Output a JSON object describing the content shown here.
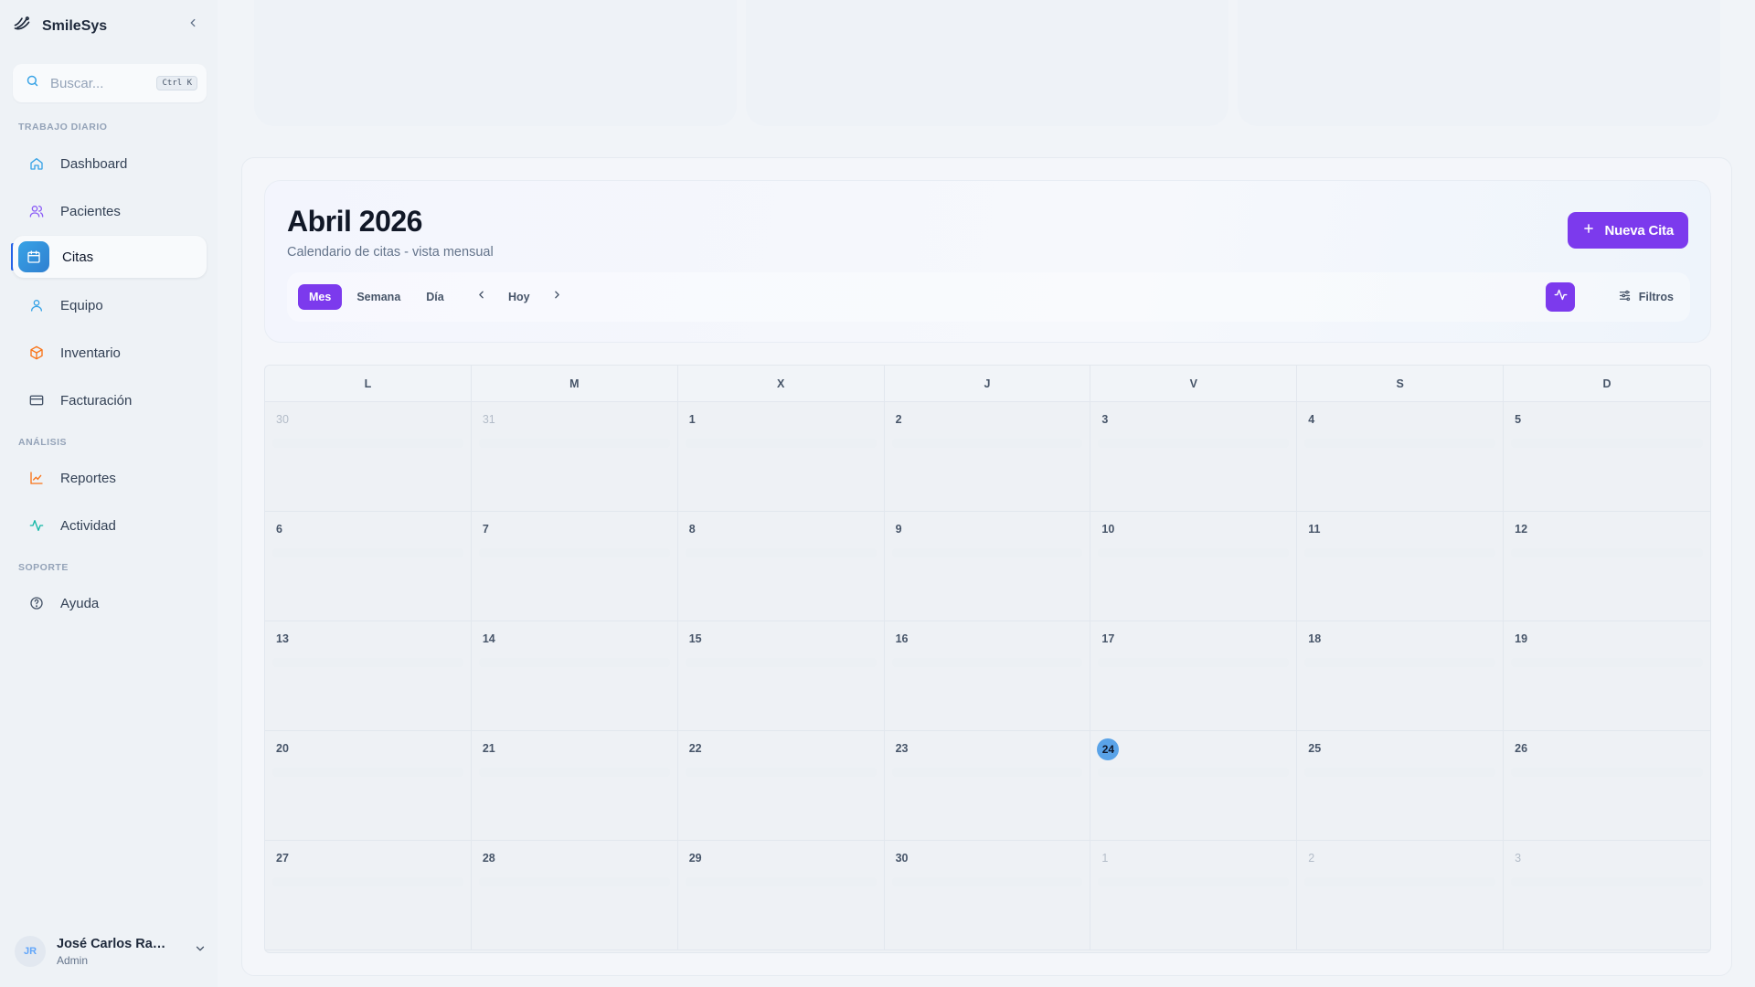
{
  "app": {
    "name": "SmileSys"
  },
  "search": {
    "placeholder": "Buscar...",
    "shortcut": "Ctrl K"
  },
  "sidebar": {
    "sections": [
      {
        "label": "TRABAJO DIARIO"
      },
      {
        "label": "ANÁLISIS"
      },
      {
        "label": "SOPORTE"
      }
    ],
    "items": [
      {
        "label": "Dashboard",
        "icon": "home-icon"
      },
      {
        "label": "Pacientes",
        "icon": "users-icon"
      },
      {
        "label": "Citas",
        "icon": "calendar-icon",
        "active": true
      },
      {
        "label": "Equipo",
        "icon": "user-icon"
      },
      {
        "label": "Inventario",
        "icon": "box-icon"
      },
      {
        "label": "Facturación",
        "icon": "credit-card-icon"
      },
      {
        "label": "Reportes",
        "icon": "line-chart-icon"
      },
      {
        "label": "Actividad",
        "icon": "activity-icon"
      },
      {
        "label": "Ayuda",
        "icon": "help-circle-icon"
      }
    ]
  },
  "user": {
    "initials": "JR",
    "name": "José Carlos Ramír...",
    "role": "Admin"
  },
  "calendar": {
    "title": "Abril 2026",
    "subtitle": "Calendario de citas - vista mensual",
    "new_button": "Nueva Cita",
    "views": [
      "Mes",
      "Semana",
      "Día"
    ],
    "active_view": "Mes",
    "today_label": "Hoy",
    "filters_label": "Filtros",
    "weekdays": [
      "L",
      "M",
      "X",
      "J",
      "V",
      "S",
      "D"
    ],
    "days": [
      "30",
      "31",
      "1",
      "2",
      "3",
      "4",
      "5",
      "6",
      "7",
      "8",
      "9",
      "10",
      "11",
      "12",
      "13",
      "14",
      "15",
      "16",
      "17",
      "18",
      "19",
      "20",
      "21",
      "22",
      "23",
      "24",
      "25",
      "26",
      "27",
      "28",
      "29",
      "30",
      "1",
      "2",
      "3"
    ],
    "outside_month_indexes": [
      0,
      1,
      32,
      33,
      34
    ],
    "today_index": 25
  },
  "colors": {
    "accent": "#7c3aed",
    "active_nav": "#2f7fd0",
    "today": "#5aa3e8"
  }
}
